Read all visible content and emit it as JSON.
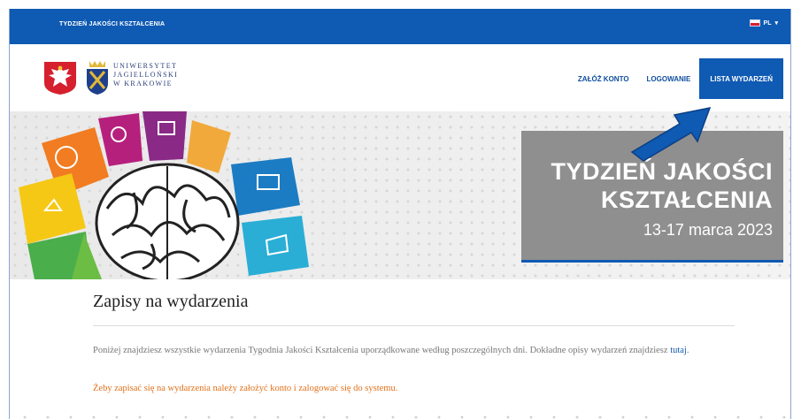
{
  "topbar": {
    "site_title": "TYDZIEŃ JAKOŚCI KSZTAŁCENIA",
    "language": "PL",
    "language_caret": "▾"
  },
  "header": {
    "university_lines": [
      "UNIWERSYTET",
      "JAGIELLOŃSKI",
      "W KRAKOWIE"
    ],
    "nav": {
      "register": "ZAŁÓŻ KONTO",
      "login": "LOGOWANIE",
      "events": "LISTA WYDARZEŃ"
    }
  },
  "hero": {
    "title_line1": "TYDZIEŃ JAKOŚCI",
    "title_line2": "KSZTAŁCENIA",
    "dates": "13-17 marca 2023"
  },
  "content": {
    "title": "Zapisy na wydarzenia",
    "intro_text": "Poniżej znajdziesz wszystkie wydarzenia Tygodnia Jakości Kształcenia uporządkowane według poszczególnych dni. Dokładne opisy wydarzeń znajdziesz ",
    "intro_link": "tutaj",
    "intro_end": ".",
    "warning": "Żeby zapisać się na wydarzenia należy założyć konto i zalogować się do systemu."
  },
  "colors": {
    "brand_blue": "#0f5ab3",
    "warning_orange": "#e0701a",
    "hero_box_gray": "#8f8f8f"
  }
}
